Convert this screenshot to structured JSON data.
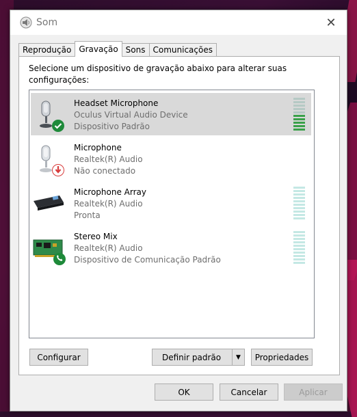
{
  "window": {
    "title": "Som",
    "close_glyph": "✕"
  },
  "tabs": [
    {
      "label": "Reprodução",
      "active": false
    },
    {
      "label": "Gravação",
      "active": true
    },
    {
      "label": "Sons",
      "active": false
    },
    {
      "label": "Comunicações",
      "active": false
    }
  ],
  "panel": {
    "instructions": "Selecione um dispositivo de gravação abaixo para alterar suas configurações:"
  },
  "devices": [
    {
      "name": "Headset Microphone",
      "driver": "Oculus Virtual Audio Device",
      "status": "Dispositivo Padrão",
      "icon": "headset-microphone-icon",
      "badge": "default-check-icon",
      "selected": true,
      "level": 0.5
    },
    {
      "name": "Microphone",
      "driver": "Realtek(R) Audio",
      "status": "Não conectado",
      "icon": "microphone-icon",
      "badge": "disconnected-arrow-icon",
      "selected": false,
      "level": 0
    },
    {
      "name": "Microphone Array",
      "driver": "Realtek(R) Audio",
      "status": "Pronta",
      "icon": "microphone-array-icon",
      "badge": "",
      "selected": false,
      "level": 0
    },
    {
      "name": "Stereo Mix",
      "driver": "Realtek(R) Audio",
      "status": "Dispositivo de Comunicação Padrão",
      "icon": "stereo-mix-card-icon",
      "badge": "communication-phone-icon",
      "selected": false,
      "level": 0
    }
  ],
  "buttons": {
    "configure": "Configurar",
    "set_default": "Definir padrão",
    "properties": "Propriedades",
    "ok": "OK",
    "cancel": "Cancelar",
    "apply": "Aplicar"
  },
  "colors": {
    "check_badge": "#1e8a3a",
    "arrow_badge": "#d83b3b",
    "meter_active": "#3aa14a",
    "meter_idle": "#c4e8e4"
  }
}
